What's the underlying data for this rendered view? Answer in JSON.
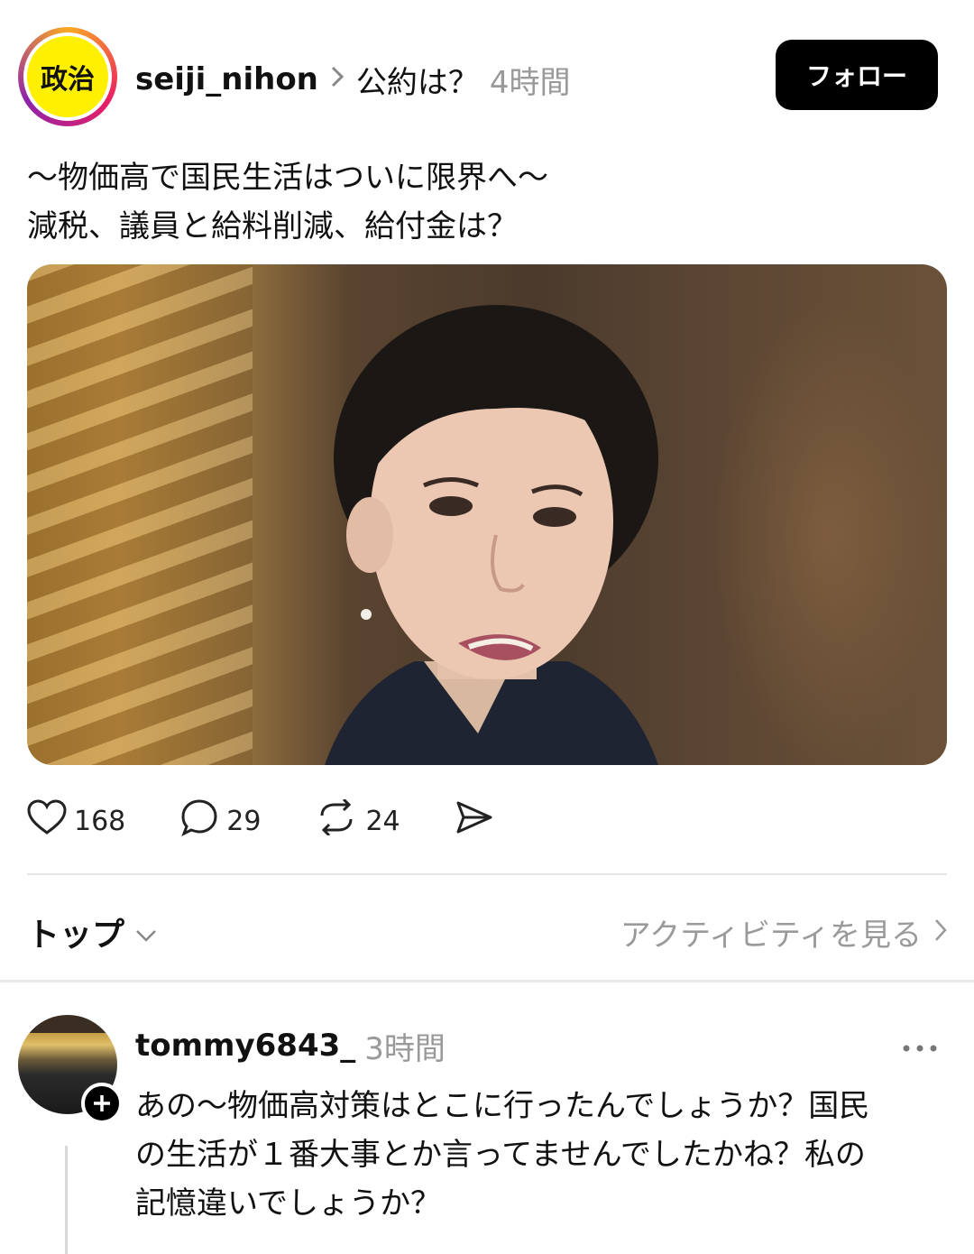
{
  "header": {
    "avatar_text": "政治",
    "username": "seiji_nihon",
    "separator": ">",
    "topic": "公約は？",
    "time": "4時間",
    "follow_label": "フォロー"
  },
  "post": {
    "lines": [
      "〜物価高で国民生活はついに限界へ〜",
      "減税、議員と給料削減、給付金は？"
    ]
  },
  "actions": {
    "likes": "168",
    "comments": "29",
    "reposts": "24"
  },
  "sort": {
    "label": "トップ",
    "activity_label": "アクティビティを見る"
  },
  "comment": {
    "username": "tommy6843_",
    "time": "3時間",
    "lines": [
      "あの〜物価高対策はとこに行ったんでしょうか？国民",
      "の生活が１番大事とか言ってませんでしたかね？私の",
      "記憶違いでしょうか？"
    ]
  },
  "colors": {
    "avatar_yellow": "#ffef00",
    "follow_bg": "#000000",
    "muted": "#999999"
  },
  "icons": [
    "heart-icon",
    "comment-icon",
    "repost-icon",
    "share-icon",
    "chevron-down-icon",
    "chevron-right-icon",
    "more-icon",
    "plus-icon"
  ]
}
